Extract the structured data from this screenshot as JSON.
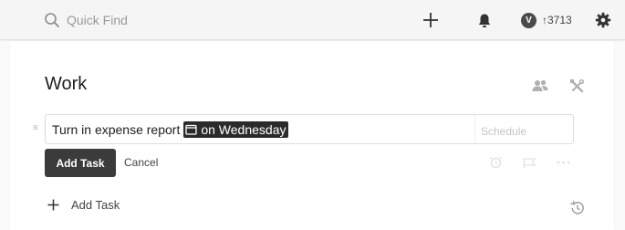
{
  "topbar": {
    "search_placeholder": "Quick Find",
    "add_icon": "plus-icon",
    "notifications_icon": "bell-icon",
    "karma_badge": "V",
    "karma_count": "↑3713",
    "settings_icon": "gear-icon"
  },
  "project": {
    "title": "Work",
    "share_icon": "people-icon",
    "settings_icon": "tools-icon"
  },
  "editor": {
    "task_text": "Turn in expense report",
    "date_chip": "on Wednesday",
    "schedule_placeholder": "Schedule"
  },
  "actions": {
    "add_task_button": "Add Task",
    "cancel_link": "Cancel",
    "reminder_icon": "alarm-icon",
    "label_icon": "label-icon",
    "more_icon": "more-icon"
  },
  "footer": {
    "add_task_label": "Add Task",
    "history_icon": "history-icon"
  },
  "colors": {
    "topbar_bg": "#f5f5f5",
    "button_bg": "#3b3b3b",
    "chip_bg": "#2b2b2b",
    "page_bg": "#fafafa"
  }
}
